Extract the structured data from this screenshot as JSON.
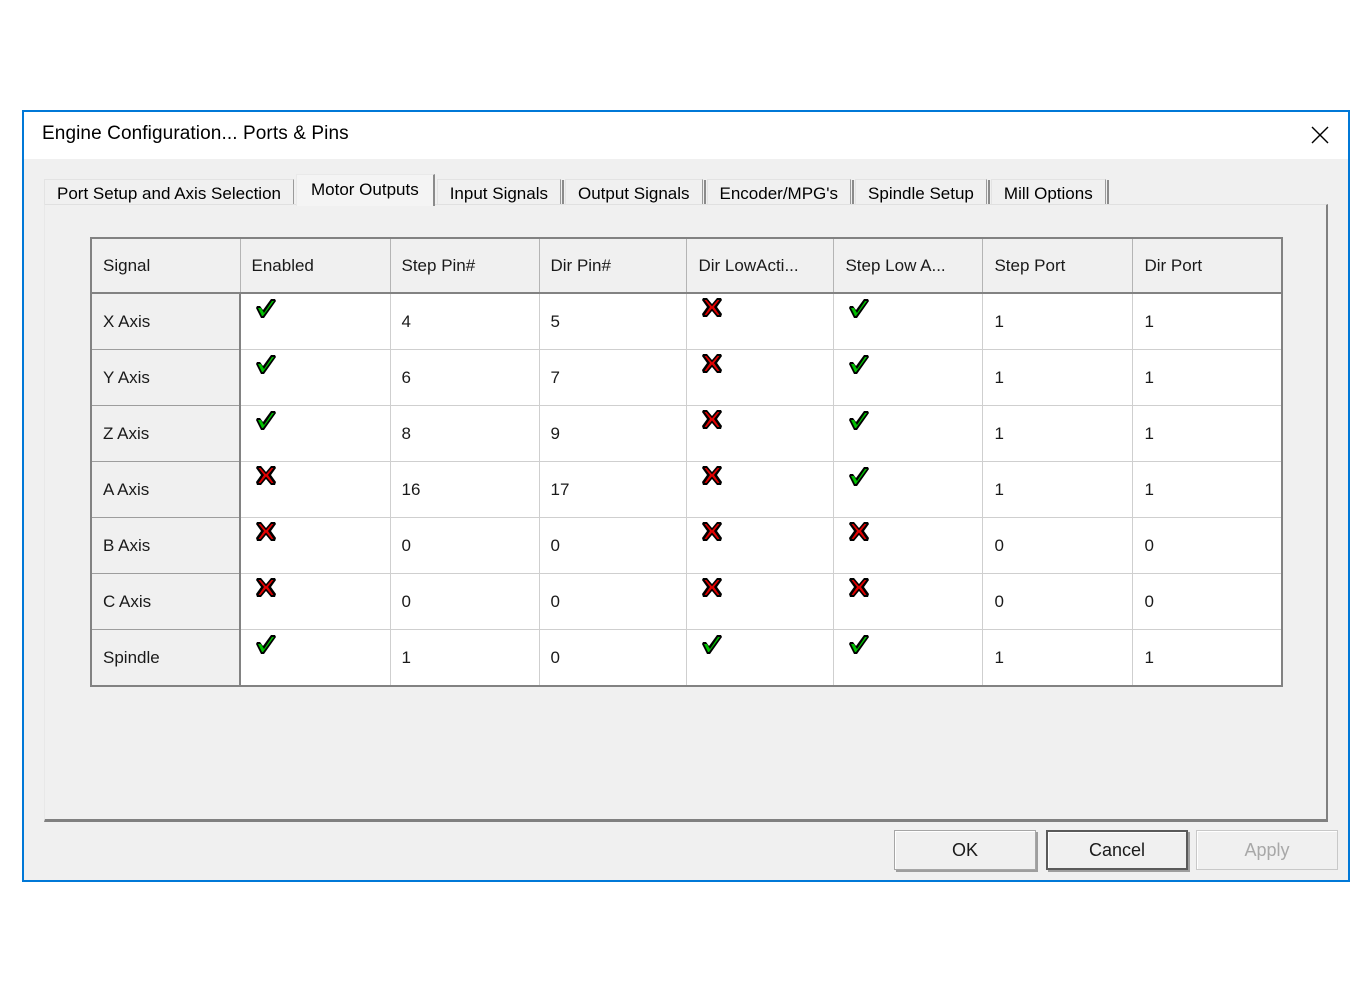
{
  "window": {
    "title": "Engine Configuration... Ports & Pins",
    "close_label": "✕",
    "accent_color": "#0078d7"
  },
  "tabs": [
    {
      "label": "Port Setup and Axis Selection",
      "selected": false
    },
    {
      "label": "Motor Outputs",
      "selected": true
    },
    {
      "label": "Input Signals",
      "selected": false
    },
    {
      "label": "Output Signals",
      "selected": false
    },
    {
      "label": "Encoder/MPG's",
      "selected": false
    },
    {
      "label": "Spindle Setup",
      "selected": false
    },
    {
      "label": "Mill Options",
      "selected": false
    }
  ],
  "grid": {
    "headers": [
      "Signal",
      "Enabled",
      "Step Pin#",
      "Dir Pin#",
      "Dir LowActi...",
      "Step Low A...",
      "Step Port",
      "Dir Port"
    ],
    "rows": [
      {
        "signal": "X Axis",
        "enabled": "check",
        "step_pin": "4",
        "dir_pin": "5",
        "dir_low_active": "cross",
        "step_low_active": "check",
        "step_port": "1",
        "dir_port": "1"
      },
      {
        "signal": "Y Axis",
        "enabled": "check",
        "step_pin": "6",
        "dir_pin": "7",
        "dir_low_active": "cross",
        "step_low_active": "check",
        "step_port": "1",
        "dir_port": "1"
      },
      {
        "signal": "Z Axis",
        "enabled": "check",
        "step_pin": "8",
        "dir_pin": "9",
        "dir_low_active": "cross",
        "step_low_active": "check",
        "step_port": "1",
        "dir_port": "1"
      },
      {
        "signal": "A Axis",
        "enabled": "cross",
        "step_pin": "16",
        "dir_pin": "17",
        "dir_low_active": "cross",
        "step_low_active": "check",
        "step_port": "1",
        "dir_port": "1"
      },
      {
        "signal": "B Axis",
        "enabled": "cross",
        "step_pin": "0",
        "dir_pin": "0",
        "dir_low_active": "cross",
        "step_low_active": "cross",
        "step_port": "0",
        "dir_port": "0"
      },
      {
        "signal": "C Axis",
        "enabled": "cross",
        "step_pin": "0",
        "dir_pin": "0",
        "dir_low_active": "cross",
        "step_low_active": "cross",
        "step_port": "0",
        "dir_port": "0"
      },
      {
        "signal": "Spindle",
        "enabled": "check",
        "step_pin": "1",
        "dir_pin": "0",
        "dir_low_active": "check",
        "step_low_active": "check",
        "step_port": "1",
        "dir_port": "1"
      }
    ],
    "icons": {
      "check": {
        "name": "green-check-icon",
        "color": "#00c000"
      },
      "cross": {
        "name": "red-cross-icon",
        "color": "#e00000"
      }
    }
  },
  "footer": {
    "ok_label": "OK",
    "cancel_label": "Cancel",
    "apply_label": "Apply"
  }
}
